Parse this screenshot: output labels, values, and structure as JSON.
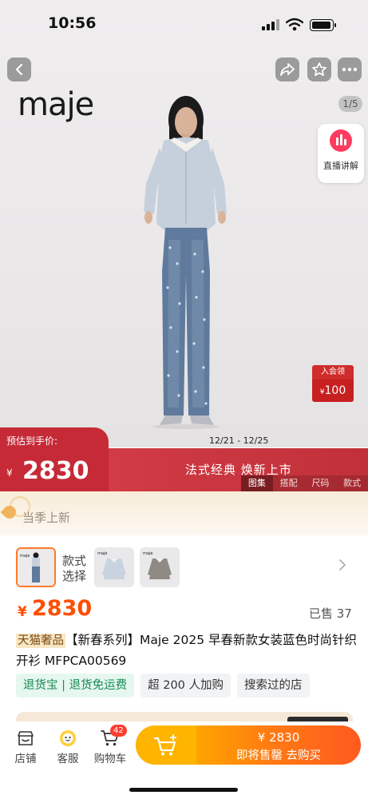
{
  "status": {
    "time": "10:56"
  },
  "hero": {
    "brand": "maje",
    "image_counter": "1/5",
    "live_label": "直播讲解",
    "coupon_top": "入会领",
    "coupon_currency": "¥",
    "coupon_value": "100"
  },
  "price_banner": {
    "label": "预估到手价:",
    "currency": "¥",
    "price": "2830",
    "dates": "12/21 - 12/25",
    "slogan": "法式经典 焕新上市",
    "tabs": [
      "图集",
      "搭配",
      "尺码",
      "款式"
    ],
    "active_tab": "图集"
  },
  "season": {
    "label": "当季上新"
  },
  "styles": {
    "label_line1": "款式",
    "label_line2": "选择",
    "thumb_brand": "maje"
  },
  "price": {
    "currency": "¥",
    "value": "2830",
    "sold": "已售 37"
  },
  "title": {
    "tag": "天猫奢品",
    "text": "【新春系列】Maje 2025 早春新款女装蓝色时尚针织开衫 MFPCA00569"
  },
  "services": [
    "退货宝 | 退货免运费",
    "超 200 人加购",
    "搜索过的店"
  ],
  "bottom": {
    "shop": "店铺",
    "service": "客服",
    "cart": "购物车",
    "cart_count": "42",
    "buy_price": "¥ 2830",
    "buy_label": "即将售罄  去购买"
  },
  "colors": {
    "accent": "#ff4e00",
    "banner_red": "#c62a37",
    "buy_gradient_end": "#ff5a1f"
  }
}
